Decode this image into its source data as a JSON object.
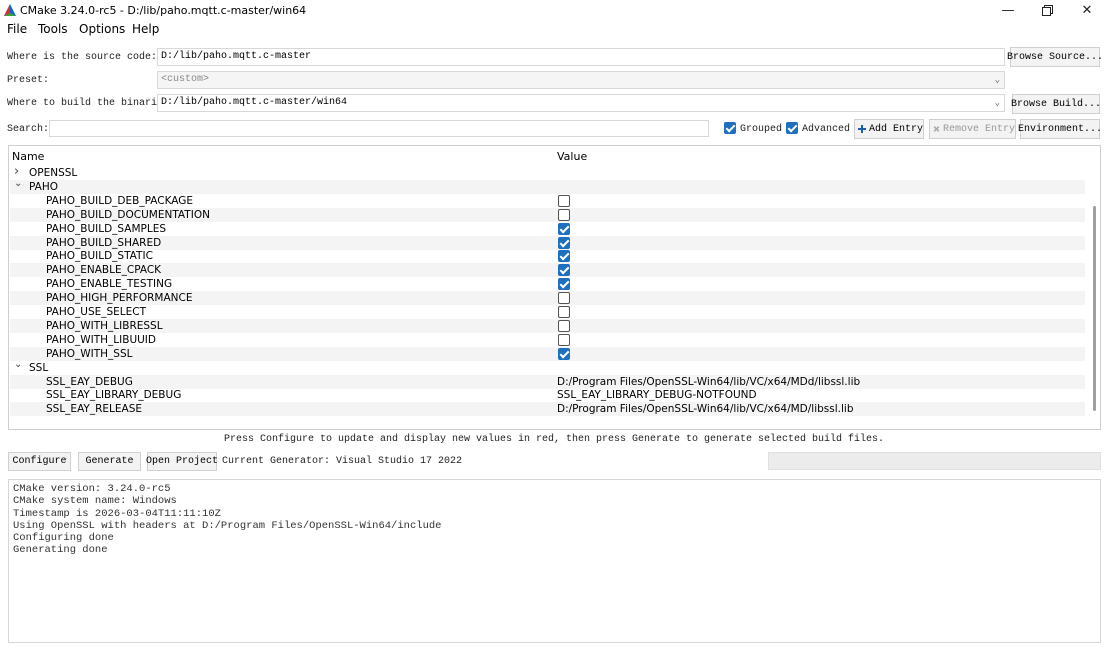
{
  "window": {
    "title": "CMake 3.24.0-rc5 - D:/lib/paho.mqtt.c-master/win64"
  },
  "menu": [
    "File",
    "Tools",
    "Options",
    "Help"
  ],
  "source": {
    "label": "Where is the source code:",
    "value": "D:/lib/paho.mqtt.c-master",
    "browse_label": "Browse Source..."
  },
  "preset": {
    "label": "Preset:",
    "value": "<custom>"
  },
  "build": {
    "label": "Where to build the binaries:",
    "value": "D:/lib/paho.mqtt.c-master/win64",
    "browse_label": "Browse Build..."
  },
  "search": {
    "label": "Search:",
    "value": "",
    "grouped_label": "Grouped",
    "grouped_checked": true,
    "advanced_label": "Advanced",
    "advanced_checked": true,
    "add_entry_label": "Add Entry",
    "remove_entry_label": "Remove Entry",
    "environment_label": "Environment..."
  },
  "table": {
    "col_name": "Name",
    "col_value": "Value",
    "rows": [
      {
        "type": "group",
        "name": "OPENSSL",
        "expanded": false
      },
      {
        "type": "group",
        "name": "PAHO",
        "expanded": true
      },
      {
        "type": "bool",
        "name": "PAHO_BUILD_DEB_PACKAGE",
        "checked": false
      },
      {
        "type": "bool",
        "name": "PAHO_BUILD_DOCUMENTATION",
        "checked": false
      },
      {
        "type": "bool",
        "name": "PAHO_BUILD_SAMPLES",
        "checked": true
      },
      {
        "type": "bool",
        "name": "PAHO_BUILD_SHARED",
        "checked": true
      },
      {
        "type": "bool",
        "name": "PAHO_BUILD_STATIC",
        "checked": true
      },
      {
        "type": "bool",
        "name": "PAHO_ENABLE_CPACK",
        "checked": true
      },
      {
        "type": "bool",
        "name": "PAHO_ENABLE_TESTING",
        "checked": true
      },
      {
        "type": "bool",
        "name": "PAHO_HIGH_PERFORMANCE",
        "checked": false
      },
      {
        "type": "bool",
        "name": "PAHO_USE_SELECT",
        "checked": false
      },
      {
        "type": "bool",
        "name": "PAHO_WITH_LIBRESSL",
        "checked": false
      },
      {
        "type": "bool",
        "name": "PAHO_WITH_LIBUUID",
        "checked": false
      },
      {
        "type": "bool",
        "name": "PAHO_WITH_SSL",
        "checked": true
      },
      {
        "type": "group",
        "name": "SSL",
        "expanded": true
      },
      {
        "type": "text",
        "name": "SSL_EAY_DEBUG",
        "value": "D:/Program Files/OpenSSL-Win64/lib/VC/x64/MDd/libssl.lib"
      },
      {
        "type": "text",
        "name": "SSL_EAY_LIBRARY_DEBUG",
        "value": "SSL_EAY_LIBRARY_DEBUG-NOTFOUND"
      },
      {
        "type": "text",
        "name": "SSL_EAY_RELEASE",
        "value": "D:/Program Files/OpenSSL-Win64/lib/VC/x64/MD/libssl.lib"
      }
    ]
  },
  "hint": "Press Configure to update and display new values in red, then press Generate to generate selected build files.",
  "actions": {
    "configure_label": "Configure",
    "generate_label": "Generate",
    "open_project_label": "Open Project",
    "generator_text": "Current Generator: Visual Studio 17 2022"
  },
  "output_lines": [
    "CMake version: 3.24.0-rc5",
    "CMake system name: Windows",
    "Timestamp is 2026-03-04T11:11:10Z",
    "Using OpenSSL with headers at D:/Program Files/OpenSSL-Win64/include",
    "Configuring done",
    "Generating done"
  ],
  "colors": {
    "checkbox_on": "#1f6fbf",
    "alt_row": "#f4f4f4"
  }
}
